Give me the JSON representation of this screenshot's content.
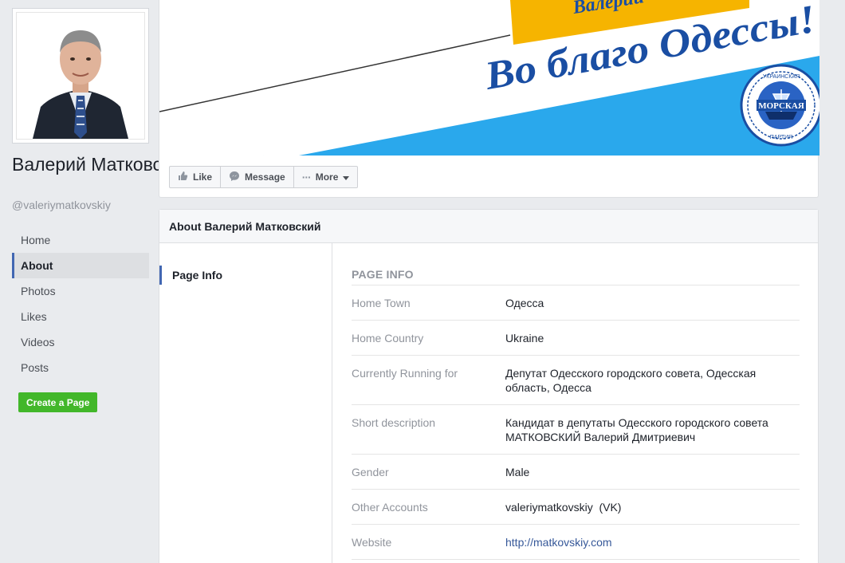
{
  "page": {
    "name": "Валерий Матковский",
    "handle": "@valeriymatkovskiy"
  },
  "nav": [
    {
      "label": "Home",
      "active": false
    },
    {
      "label": "About",
      "active": true
    },
    {
      "label": "Photos",
      "active": false
    },
    {
      "label": "Likes",
      "active": false
    },
    {
      "label": "Videos",
      "active": false
    },
    {
      "label": "Posts",
      "active": false
    }
  ],
  "create_page_label": "Create a Page",
  "cover": {
    "top_band_text": "Валерий",
    "slogan": "Во благо Одессы!",
    "emblem_top": "УКРАИНСКАЯ",
    "emblem_middle": "МОРСКАЯ",
    "emblem_bottom": "ПАРТИЯ",
    "colors": {
      "blue": "#2aa8ec",
      "yellow": "#f6b400",
      "text_blue": "#1a4ea3"
    }
  },
  "actions": {
    "like": "Like",
    "message": "Message",
    "more": "More"
  },
  "about": {
    "header": "About Валерий Матковский",
    "side_item": "Page Info",
    "section_title": "PAGE INFO",
    "rows": [
      {
        "label": "Home Town",
        "value": "Одесса"
      },
      {
        "label": "Home Country",
        "value": "Ukraine"
      },
      {
        "label": "Currently Running for",
        "value": "Депутат Одесского городского совета, Одесская область, Одесса"
      },
      {
        "label": "Short description",
        "value": "Кандидат в депутаты Одесского городского совета МАТКОВСКИЙ Валерий Дмитриевич"
      },
      {
        "label": "Gender",
        "value": "Male"
      },
      {
        "label": "Other Accounts",
        "value": "valeriymatkovskiy  (VK)"
      },
      {
        "label": "Website",
        "value": "http://matkovskiy.com"
      }
    ]
  }
}
